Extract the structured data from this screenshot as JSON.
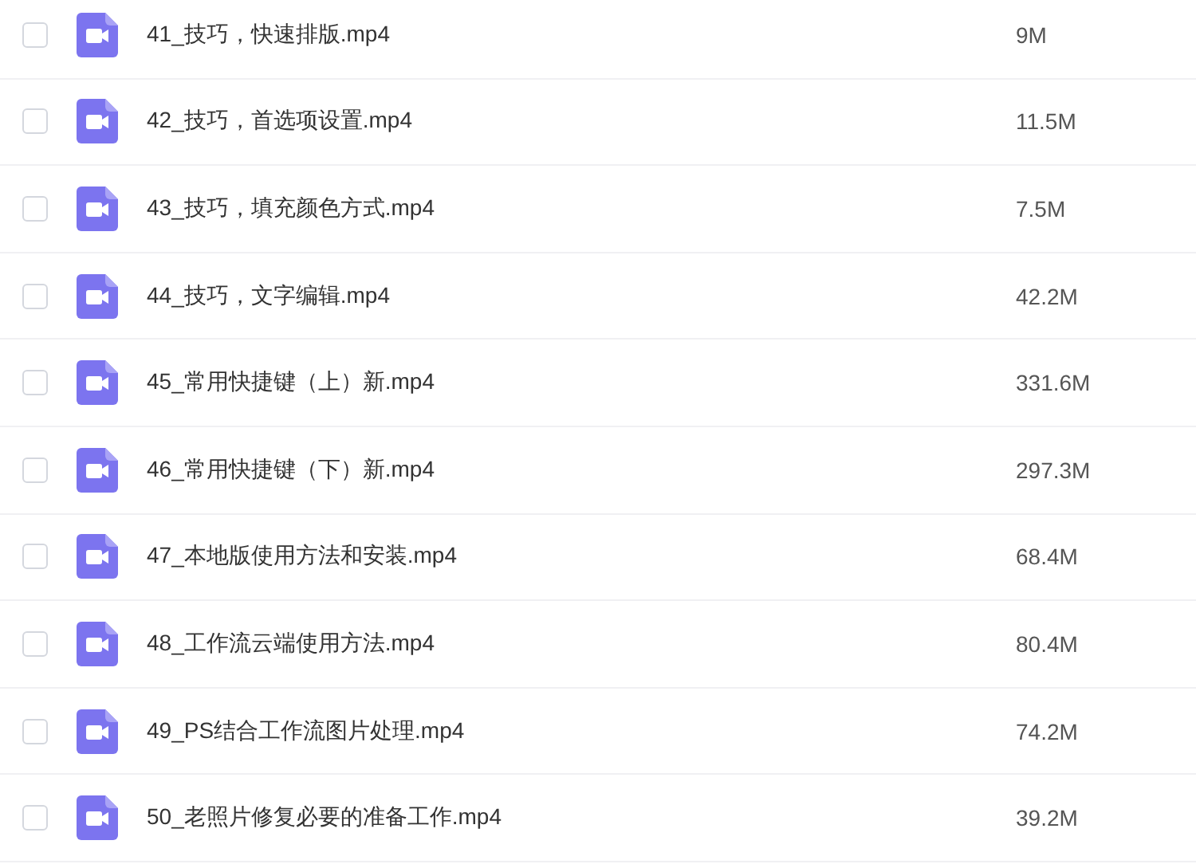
{
  "files": [
    {
      "name": "41_技巧，快速排版.mp4",
      "size": "9M",
      "checked": false
    },
    {
      "name": "42_技巧，首选项设置.mp4",
      "size": "11.5M",
      "checked": false
    },
    {
      "name": "43_技巧，填充颜色方式.mp4",
      "size": "7.5M",
      "checked": false
    },
    {
      "name": "44_技巧，文字编辑.mp4",
      "size": "42.2M",
      "checked": false
    },
    {
      "name": "45_常用快捷键（上）新.mp4",
      "size": "331.6M",
      "checked": false
    },
    {
      "name": "46_常用快捷键（下）新.mp4",
      "size": "297.3M",
      "checked": false
    },
    {
      "name": "47_本地版使用方法和安装.mp4",
      "size": "68.4M",
      "checked": false
    },
    {
      "name": "48_工作流云端使用方法.mp4",
      "size": "80.4M",
      "checked": false
    },
    {
      "name": "49_PS结合工作流图片处理.mp4",
      "size": "74.2M",
      "checked": false
    },
    {
      "name": "50_老照片修复必要的准备工作.mp4",
      "size": "39.2M",
      "checked": false
    }
  ]
}
